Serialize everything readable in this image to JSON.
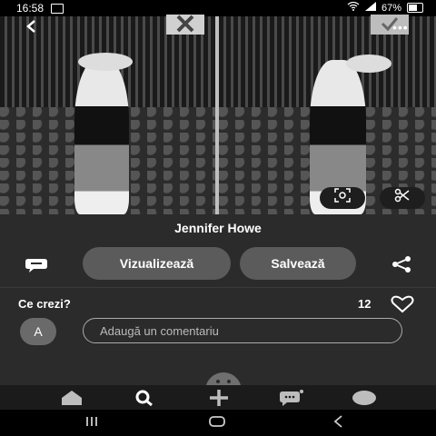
{
  "status_bar": {
    "time": "16:58",
    "battery": "67%"
  },
  "post": {
    "title": "Jennifer Howe"
  },
  "actions": {
    "view_label": "Vizualizează",
    "save_label": "Salvează"
  },
  "comments": {
    "prompt": "Ce crezi?",
    "like_count": "12",
    "avatar_initial": "A",
    "input_placeholder": "Adaugă un comentariu"
  },
  "icons": {
    "back": "chevron-left-icon",
    "close": "close-icon",
    "check": "check-icon",
    "lens": "visual-search-icon",
    "scissors": "scissors-icon",
    "comment": "comment-bubble-icon",
    "share": "share-icon",
    "heart": "heart-icon",
    "nav": [
      "home-icon",
      "search-icon",
      "plus-icon",
      "chat-icon",
      "profile-icon"
    ]
  },
  "colors": {
    "background": "#2b2b2b",
    "pill": "#5b5b5b",
    "nav_bar": "#1b1b1b"
  }
}
